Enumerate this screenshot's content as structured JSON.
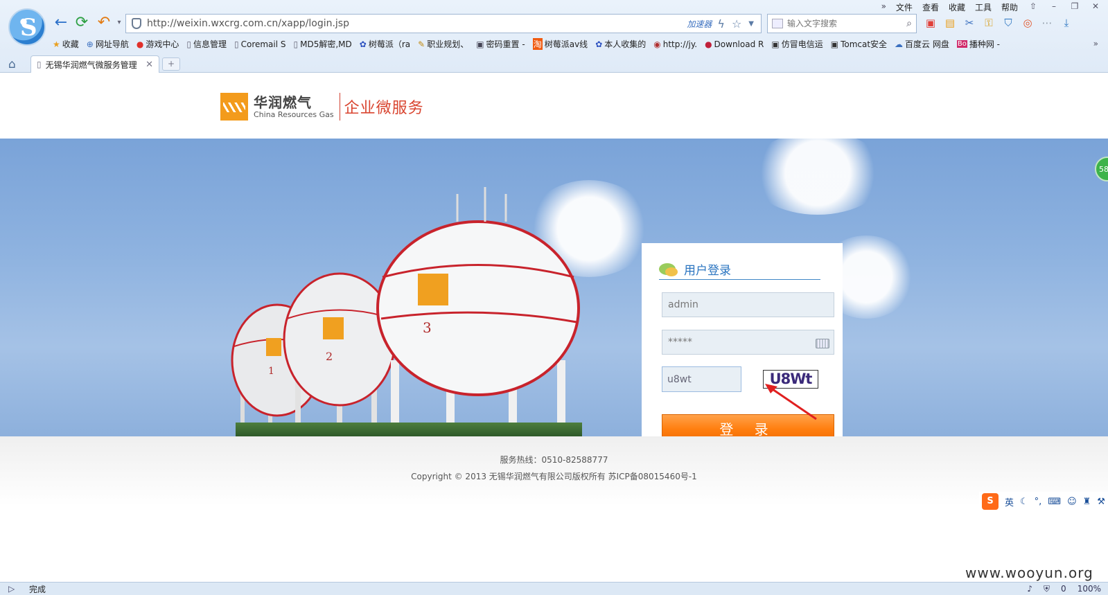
{
  "menubar": {
    "overflow": "»",
    "items": [
      "文件",
      "查看",
      "收藏",
      "工具",
      "帮助"
    ],
    "window_buttons": [
      "⇧",
      "–",
      "❐",
      "✕"
    ]
  },
  "address": {
    "url": "http://weixin.wxcrg.com.cn/xapp/login.jsp",
    "accelerator": "加速器"
  },
  "search": {
    "placeholder": "输入文字搜索"
  },
  "bookmarks": [
    {
      "icon": "★",
      "label": "收藏"
    },
    {
      "icon": "⊕",
      "label": "网址导航"
    },
    {
      "icon": "●",
      "label": "游戏中心"
    },
    {
      "icon": "▯",
      "label": "信息管理"
    },
    {
      "icon": "▯",
      "label": "Coremail S"
    },
    {
      "icon": "▯",
      "label": "MD5解密,MD"
    },
    {
      "icon": "✿",
      "label": "树莓派（ra"
    },
    {
      "icon": "✎",
      "label": "职业规划、"
    },
    {
      "icon": "▣",
      "label": "密码重置 -"
    },
    {
      "icon": "淘",
      "label": "树莓派av线"
    },
    {
      "icon": "✿",
      "label": "本人收集的"
    },
    {
      "icon": "◉",
      "label": "http://jy."
    },
    {
      "icon": "●",
      "label": "Download R"
    },
    {
      "icon": "▣",
      "label": "仿冒电信运"
    },
    {
      "icon": "▣",
      "label": "Tomcat安全"
    },
    {
      "icon": "☁",
      "label": "百度云 网盘"
    },
    {
      "icon": "Bo",
      "label": "播种网 -"
    }
  ],
  "bookmarks_more": "»",
  "tab": {
    "title": "无锡华润燃气微服务管理",
    "close": "✕",
    "new": "+"
  },
  "brand": {
    "name_cn": "华润燃气",
    "name_en": "China Resources Gas",
    "service": "企业微服务"
  },
  "login": {
    "title": "用户登录",
    "username": "admin",
    "password": "*****",
    "captcha_input": "u8wt",
    "captcha_image_text": "U8Wt",
    "submit": "登 录"
  },
  "footer": {
    "hotline": "服务热线：0510-82588777",
    "copyright": "Copyright © 2013 无锡华润燃气有限公司版权所有 苏ICP备08015460号-1"
  },
  "float_badge": "58",
  "ime": {
    "logo": "S",
    "mode": "英"
  },
  "watermark": "www.wooyun.org",
  "status": {
    "text": "完成",
    "zoom": "100%",
    "count": "0"
  }
}
